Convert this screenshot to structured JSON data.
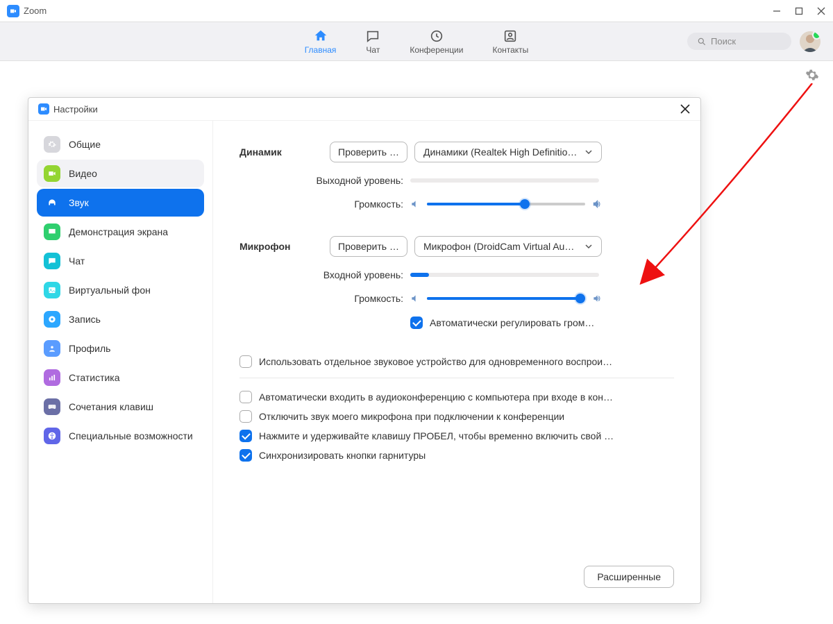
{
  "window": {
    "title": "Zoom"
  },
  "nav": {
    "tabs": [
      {
        "label": "Главная",
        "icon": "home",
        "active": true
      },
      {
        "label": "Чат",
        "icon": "chat"
      },
      {
        "label": "Конференции",
        "icon": "clock"
      },
      {
        "label": "Контакты",
        "icon": "contacts"
      }
    ],
    "search_placeholder": "Поиск"
  },
  "dialog": {
    "title": "Настройки",
    "sidebar": [
      {
        "label": "Общие",
        "icon_bg": "#d7d7dc",
        "key": "general",
        "icon": "gear"
      },
      {
        "label": "Видео",
        "icon_bg": "#94d532",
        "key": "video",
        "icon": "video",
        "hover": true
      },
      {
        "label": "Звук",
        "icon_bg": "#0e72ed",
        "key": "audio",
        "icon": "headphones",
        "active": true
      },
      {
        "label": "Демонстрация экрана",
        "icon_bg": "#2fcf6e",
        "key": "share",
        "icon": "share"
      },
      {
        "label": "Чат",
        "icon_bg": "#13c1d6",
        "key": "chat",
        "icon": "chat"
      },
      {
        "label": "Виртуальный фон",
        "icon_bg": "#2fd7e6",
        "key": "vbg",
        "icon": "image"
      },
      {
        "label": "Запись",
        "icon_bg": "#2ca7ff",
        "key": "recording",
        "icon": "record"
      },
      {
        "label": "Профиль",
        "icon_bg": "#5a9cff",
        "key": "profile",
        "icon": "person"
      },
      {
        "label": "Статистика",
        "icon_bg": "#b06be0",
        "key": "stats",
        "icon": "stats"
      },
      {
        "label": "Сочетания клавиш",
        "icon_bg": "#6b6fa6",
        "key": "shortcuts",
        "icon": "keyboard"
      },
      {
        "label": "Специальные возможности",
        "icon_bg": "#6066e8",
        "key": "a11y",
        "icon": "a11y"
      }
    ],
    "advanced_button": "Расширенные"
  },
  "audio": {
    "speaker": {
      "section_label": "Динамик",
      "test_label": "Проверить …",
      "device": "Динамики (Realtek High Definitio…",
      "output_level_label": "Выходной уровень:",
      "output_level_pct": 0,
      "volume_label": "Громкость:",
      "volume_pct": 62
    },
    "mic": {
      "section_label": "Микрофон",
      "test_label": "Проверить …",
      "device": "Микрофон (DroidCam Virtual Au…",
      "input_level_label": "Входной уровень:",
      "input_level_pct": 10,
      "volume_label": "Громкость:",
      "volume_pct": 97,
      "auto_adjust_label": "Автоматически регулировать гром…",
      "auto_adjust_checked": true
    },
    "options": [
      {
        "label": "Использовать отдельное звуковое устройство для одновременного воспрои…",
        "checked": false
      },
      {
        "label": "Автоматически входить в аудиоконференцию с компьютера при входе в кон…",
        "checked": false
      },
      {
        "label": "Отключить звук моего микрофона при подключении к конференции",
        "checked": false
      },
      {
        "label": "Нажмите и удерживайте клавишу ПРОБЕЛ, чтобы временно включить свой …",
        "checked": true
      },
      {
        "label": "Синхронизировать кнопки гарнитуры",
        "checked": true
      }
    ]
  }
}
